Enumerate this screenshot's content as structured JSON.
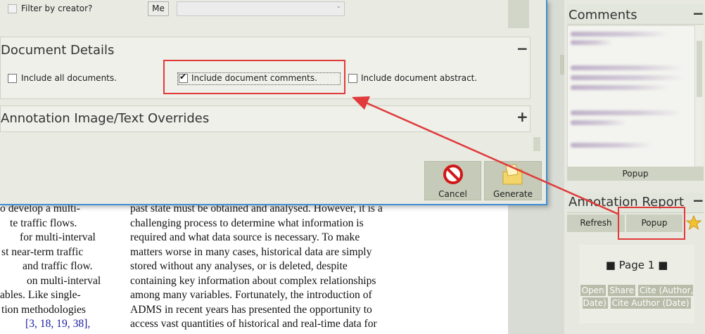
{
  "dialog": {
    "filter_label": "Filter by creator?",
    "me_button": "Me",
    "document_details_title": "Document Details",
    "document_details_toggle": "−",
    "include_all_label": "Include all documents.",
    "include_comments_label": "Include document comments.",
    "include_abstract_label": "Include document abstract.",
    "overrides_title": "Annotation Image/Text Overrides",
    "overrides_toggle": "+",
    "cancel_label": "Cancel",
    "generate_label": "Generate"
  },
  "document": {
    "left_lines": [
      "o develop a multi-",
      "te traffic flows.",
      "for multi-interval",
      "st near-term traffic",
      "and traffic flow.",
      "on multi-interval",
      "ables. Like single-",
      "tion methodologies"
    ],
    "left_refs": "[3, 18, 19, 38],",
    "right_lines": [
      "past state must be obtained and analysed. However, it is a",
      "challenging process to determine what information is",
      "required and what data source is necessary. To make",
      "matters worse in many cases, historical data are simply",
      "stored without any analyses, or is deleted, despite",
      "containing key information about complex relationships",
      "among many variables. Fortunately, the introduction of",
      "ADMS in recent years has presented the opportunity to",
      "access vast quantities of historical and real-time data for"
    ]
  },
  "comments": {
    "title": "Comments",
    "toggle": "−",
    "popup_label": "Popup"
  },
  "annotation_report": {
    "title": "Annotation Report",
    "toggle": "−",
    "refresh_label": "Refresh",
    "popup_label": "Popup",
    "page_label": "■ Page 1 ■",
    "links": [
      "Open",
      "Share",
      "Cite (Author, Date)",
      "Cite Author (Date)"
    ]
  },
  "colors": {
    "accent_red": "#e03a3a",
    "window_border": "#3c8fd6"
  }
}
